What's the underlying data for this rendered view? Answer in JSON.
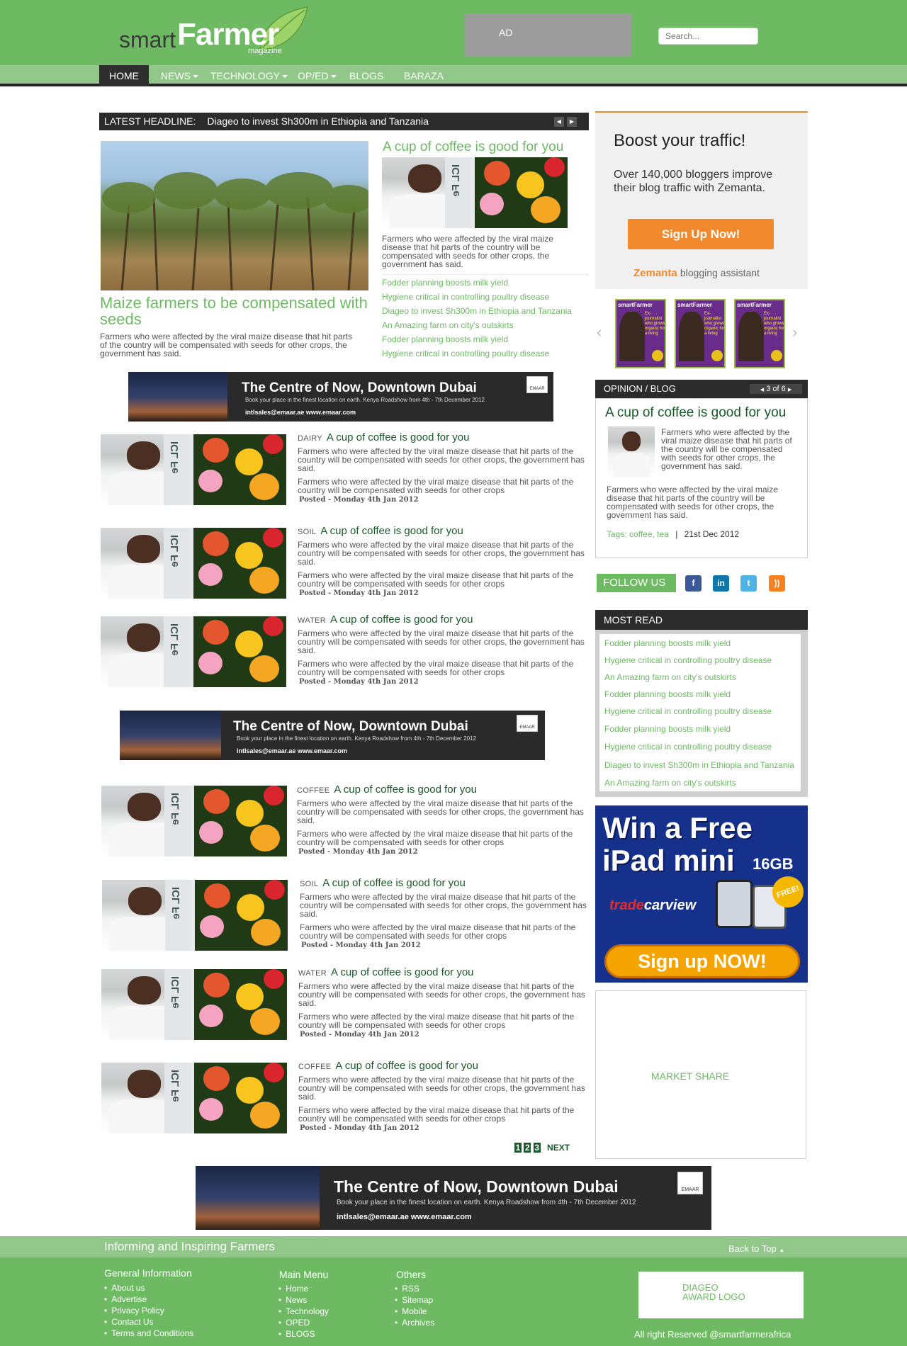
{
  "header": {
    "logo_smart": "smart",
    "logo_farmer": "Farmer",
    "logo_magazine": "magazine",
    "ad_label": "AD",
    "search_placeholder": "Search..."
  },
  "nav": {
    "items": [
      {
        "label": "HOME",
        "dropdown": false,
        "active": true
      },
      {
        "label": "NEWS",
        "dropdown": true
      },
      {
        "label": "TECHNOLOGY",
        "dropdown": true
      },
      {
        "label": "OP/ED",
        "dropdown": true
      },
      {
        "label": "BLOGS",
        "dropdown": false
      },
      {
        "label": "BARAZA",
        "dropdown": false
      }
    ]
  },
  "latest": {
    "label": "LATEST HEADLINE:",
    "headline": "Diageo to invest Sh300m in Ethiopia and Tanzania"
  },
  "feature": {
    "title": "Maize farmers to be compensated with seeds",
    "body": "Farmers who were affected by the viral maize disease that hit parts of the country will be compensated with seeds for other crops, the government has said."
  },
  "side_feature": {
    "title": "A cup of coffee is good for you",
    "body": "Farmers who were affected by the viral maize disease that hit parts of the country will be compensated with seeds for other crops, the government has said.",
    "links": [
      "Fodder planning boosts milk yield",
      "Hygiene critical in controlling poultry disease",
      "Diageo to invest Sh300m in Ethiopia and Tanzania",
      "An Amazing farm on city's outskirts",
      "Fodder planning boosts milk yield",
      "Hygiene critical in controlling poultry disease"
    ]
  },
  "banner_ad": {
    "title": "The Centre of Now, Downtown Dubai",
    "line": "Book your place in the finest location on earth. Kenya Roadshow from 4th - 7th December 2012",
    "contact": "intlsales@emaar.ae  www.emaar.com",
    "brand": "EMAAR"
  },
  "articles": [
    {
      "cat": "DAIRY",
      "title": "A cup of coffee is good for you",
      "p1": "Farmers who were affected by the viral maize disease that hit parts of the country will be compensated with seeds for other crops, the government has said.",
      "p2": "Farmers who were affected by the viral maize disease that hit parts of the country will be compensated with seeds for other crops",
      "posted": "Posted - Monday 4th Jan 2012"
    },
    {
      "cat": "SOIL",
      "title": "A cup of coffee is good for you",
      "p1": "Farmers who were affected by the viral maize disease that hit parts of the country will be compensated with seeds for other crops, the government has said.",
      "p2": "Farmers who were affected by the viral maize disease that hit parts of the country will be compensated with seeds for other crops",
      "posted": "Posted - Monday 4th Jan 2012"
    },
    {
      "cat": "WATER",
      "title": "A cup of coffee is good for you",
      "p1": "Farmers who were affected by the viral maize disease that hit parts of the country will be compensated with seeds for other crops, the government has said.",
      "p2": "Farmers who were affected by the viral maize disease that hit parts of the country will be compensated with seeds for other crops",
      "posted": "Posted - Monday 4th Jan 2012"
    },
    {
      "cat": "COFFEE",
      "title": "A cup of coffee is good for you",
      "p1": "Farmers who were affected by the viral maize disease that hit parts of the country will be compensated with seeds for other crops, the government has said.",
      "p2": "Farmers who were affected by the viral maize disease that hit parts of the country will be compensated with seeds for other crops",
      "posted": "Posted - Monday 4th Jan 2012"
    },
    {
      "cat": "SOIL",
      "title": "A cup of coffee is good for you",
      "p1": "Farmers who were affected by the viral maize disease that hit parts of the country will be compensated with seeds for other crops, the government has said.",
      "p2": "Farmers who were affected by the viral maize disease that hit parts of the country will be compensated with seeds for other crops",
      "posted": "Posted - Monday 4th Jan 2012"
    },
    {
      "cat": "WATER",
      "title": "A cup of coffee is good for you",
      "p1": "Farmers who were affected by the viral maize disease that hit parts of the country will be compensated with seeds for other crops, the government has said.",
      "p2": "Farmers who were affected by the viral maize disease that hit parts of the country will be compensated with seeds for other crops",
      "posted": "Posted - Monday 4th Jan 2012"
    },
    {
      "cat": "COFFEE",
      "title": "A cup of coffee is good for you",
      "p1": "Farmers who were affected by the viral maize disease that hit parts of the country will be compensated with seeds for other crops, the government has said.",
      "p2": "Farmers who were affected by the viral maize disease that hit parts of the country will be compensated with seeds for other crops",
      "posted": "Posted - Monday 4th Jan 2012"
    }
  ],
  "pagination": {
    "pages": [
      "1",
      "2",
      "3"
    ],
    "next": "NEXT"
  },
  "photo_banner_text": "ICL Fe",
  "zemanta": {
    "title": "Boost your traffic!",
    "body": "Over 140,000 bloggers improve their blog traffic with Zemanta.",
    "button": "Sign Up Now!",
    "brand": "Zemanta",
    "tagline": "blogging assistant"
  },
  "magazine_covers": {
    "cover_title": "smartFarmer",
    "cover_headline": "Ex-journalist who grows organic for a living"
  },
  "opinion": {
    "header": "OPINION / BLOG",
    "counter": "3 of 6",
    "title": "A cup of coffee is good for you",
    "p1": "Farmers who were affected by the viral maize disease that hit parts of the country will be compensated with seeds for other crops, the government  has said.",
    "p2": "Farmers who were affected by the viral maize disease that hit parts of the country will be compensated with seeds for other crops, the government has said.",
    "tags_label": "Tags:",
    "tags": "coffee, tea",
    "date": "21st Dec 2012"
  },
  "follow": {
    "label": "FOLLOW US",
    "icons": [
      {
        "name": "facebook-icon",
        "glyph": "f",
        "color": "#3b5998"
      },
      {
        "name": "linkedin-icon",
        "glyph": "in",
        "color": "#0e76a8"
      },
      {
        "name": "twitter-icon",
        "glyph": "t",
        "color": "#4fb3e8"
      },
      {
        "name": "rss-icon",
        "glyph": "))",
        "color": "#f58220"
      }
    ]
  },
  "most_read": {
    "header": "MOST READ",
    "links": [
      "Fodder planning boosts milk yield",
      "Hygiene critical in controlling poultry disease",
      "An Amazing farm on city's outskirts",
      "Fodder planning boosts milk yield",
      "Hygiene critical in controlling poultry disease",
      "Fodder planning boosts milk yield",
      "Hygiene critical in controlling poultry disease",
      "Diageo to invest Sh300m in Ethiopia and Tanzania",
      "An Amazing farm on city's outskirts"
    ]
  },
  "ipad_ad": {
    "line1": "Win a Free",
    "line2": "iPad mini",
    "size": "16GB",
    "brand_a": "trade",
    "brand_b": "carview",
    "free": "FREE!",
    "button": "Sign up NOW!"
  },
  "market_share": {
    "label": "MARKET SHARE"
  },
  "footer": {
    "tagline": "Informing and Inspiring Farmers",
    "back_to_top": "Back to Top",
    "col1": {
      "title": "General Information",
      "items": [
        "About us",
        "Advertise",
        "Privacy Policy",
        "Contact Us",
        "Terms and Conditions"
      ]
    },
    "col2": {
      "title": "Main Menu",
      "items": [
        "Home",
        "News",
        "Technology",
        "OPED",
        "BLOGS"
      ]
    },
    "col3": {
      "title": "Others",
      "items": [
        "RSS",
        "Sitemap",
        "Mobile",
        "Archives"
      ]
    },
    "award_line1": "DIAGEO",
    "award_line2": "AWARD LOGO",
    "copyright": "All right Reserved @smartfarmerafrica"
  }
}
